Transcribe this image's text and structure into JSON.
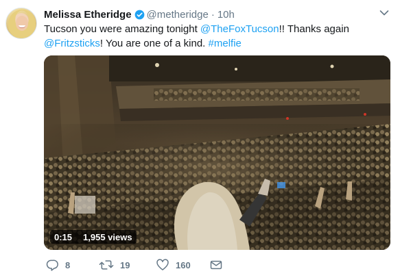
{
  "tweet": {
    "author": {
      "name": "Melissa Etheridge",
      "handle": "@metheridge",
      "verified": true
    },
    "separator": "·",
    "time": "10h",
    "text": {
      "part1": "Tucson you were amazing tonight ",
      "mention1": "@TheFoxTucson",
      "part2": "!! Thanks again ",
      "mention2": "@Fritzsticks",
      "part3": "! You are one of a kind. ",
      "hashtag": "#melfie"
    },
    "video": {
      "duration": "0:15",
      "views": "1,955 views"
    },
    "actions": {
      "replies": "8",
      "retweets": "19",
      "likes": "160"
    }
  },
  "colors": {
    "link": "#1da1f2",
    "verified": "#1da1f2",
    "muted": "#657786",
    "text": "#14171a"
  },
  "icons": [
    "verified-badge-icon",
    "chevron-down-icon",
    "reply-icon",
    "retweet-icon",
    "heart-icon",
    "envelope-icon"
  ]
}
